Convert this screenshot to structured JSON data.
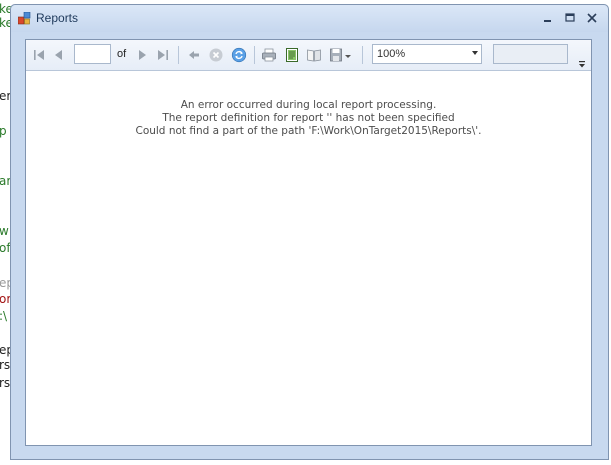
{
  "window": {
    "title": "Reports"
  },
  "toolbar": {
    "page_value": "",
    "of_label": "of",
    "zoom": "100%",
    "find_value": ""
  },
  "report": {
    "error_lines": [
      "An error occurred during local report processing.",
      "The report definition for report '' has not been specified",
      "Could not find a part of the path 'F:\\Work\\OnTarget2015\\Reports\\'."
    ]
  },
  "background_code": {
    "fragments": [
      "ke",
      "ke",
      "er",
      "p",
      "ar",
      "w",
      "of(",
      "ep",
      "or",
      ":\\",
      "ep",
      "rs",
      "rs"
    ]
  },
  "colors": {
    "title_text": "#1e395b",
    "frame": "#c8d9ef",
    "error_text": "#4c4c4c"
  }
}
